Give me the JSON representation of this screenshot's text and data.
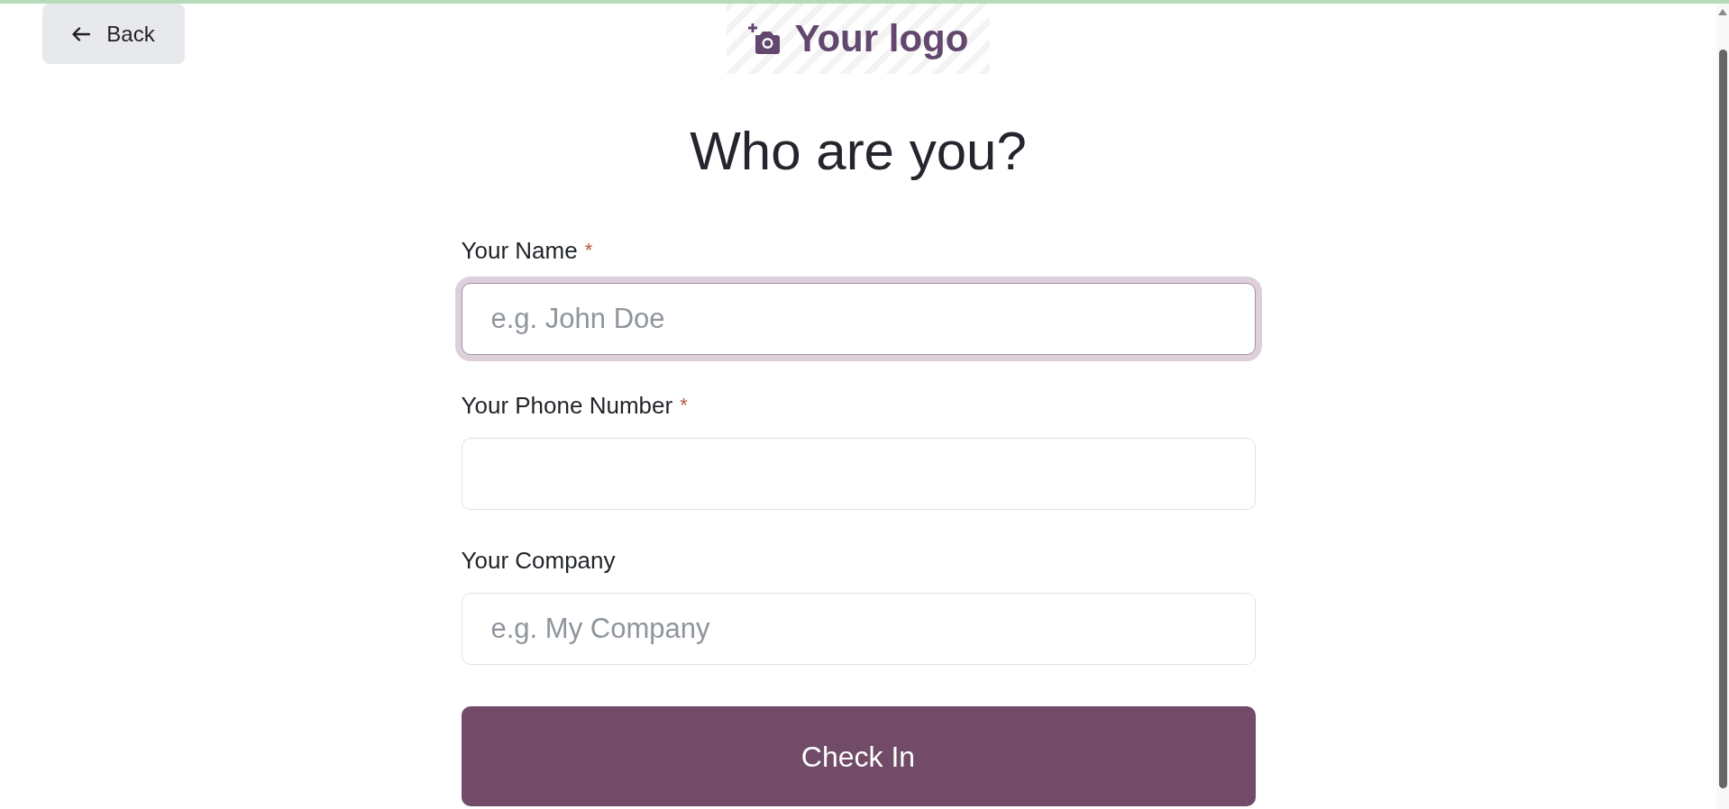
{
  "back_button": {
    "label": "Back"
  },
  "logo": {
    "text": "Your logo"
  },
  "title": "Who are you?",
  "form": {
    "fields": [
      {
        "label": "Your Name",
        "required_mark": "*",
        "placeholder": "e.g. John Doe",
        "focused": true
      },
      {
        "label": "Your Phone Number",
        "required_mark": "*",
        "focused": false
      },
      {
        "label": "Your Company",
        "placeholder": "e.g. My Company",
        "focused": false
      }
    ],
    "submit_button": {
      "label": "Check In"
    }
  }
}
